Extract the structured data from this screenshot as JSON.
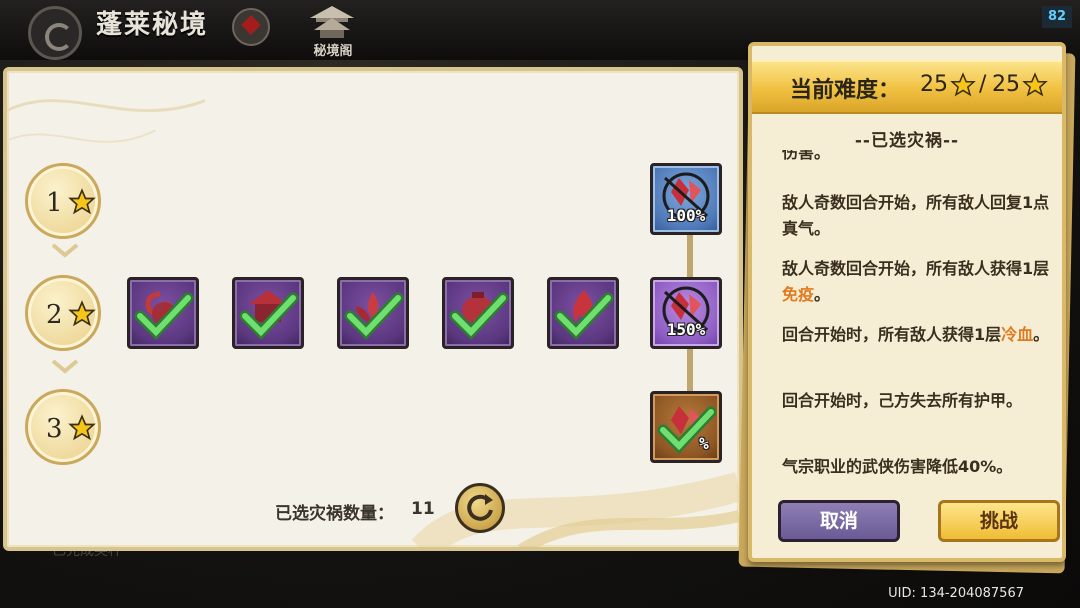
{
  "top": {
    "area_title": "蓬莱秘境",
    "pavilion_label": "秘境阁",
    "fps": "82"
  },
  "tiers": [
    {
      "label": "1",
      "icon": "star-icon"
    },
    {
      "label": "2",
      "icon": "star-icon"
    },
    {
      "label": "3",
      "icon": "star-icon"
    }
  ],
  "curses": [
    {
      "icon": "curse-spiral-icon",
      "selected": true
    },
    {
      "icon": "curse-house-icon",
      "selected": true
    },
    {
      "icon": "curse-lotus-icon",
      "selected": true
    },
    {
      "icon": "curse-pot-icon",
      "selected": true
    },
    {
      "icon": "curse-flame-icon",
      "selected": true
    }
  ],
  "ladder": [
    {
      "pct": "100%",
      "color": "blue",
      "selected": false
    },
    {
      "pct": "150%",
      "color": "violet",
      "selected": false
    },
    {
      "pct": "%",
      "color": "brown",
      "selected": true
    }
  ],
  "main": {
    "count_label": "已选灾祸数量：",
    "count_value": "11"
  },
  "side": {
    "difficulty_label": "当前难度：",
    "difficulty_value": "25",
    "difficulty_sep": "/",
    "difficulty_max": "25",
    "section_title": "--已选灾祸--",
    "effects_partial": "伤害。",
    "effects": [
      {
        "text": "敌人奇数回合开始，所有敌人回复1点真气。"
      },
      {
        "pre": "敌人奇数回合开始，所有敌人获得1层",
        "hl": "免疫",
        "post": "。"
      },
      {
        "pre": "回合开始时，所有敌人获得1层",
        "hl": "冷血",
        "post": "。"
      },
      {
        "text": "回合开始时，己方失去所有护甲。"
      },
      {
        "text": "气宗职业的武侠伤害降低40%。"
      }
    ],
    "cancel_label": "取消",
    "challenge_label": "挑战"
  },
  "footer": {
    "uid": "UID: 134-204087567",
    "ghost_text": "已完成奖杯"
  },
  "colors": {
    "parchment": "#f4f1e8",
    "gold_header": "#f0c040",
    "highlight": "#e07a1f",
    "cancel": "#6b5b96",
    "challenge": "#f0bd34"
  }
}
